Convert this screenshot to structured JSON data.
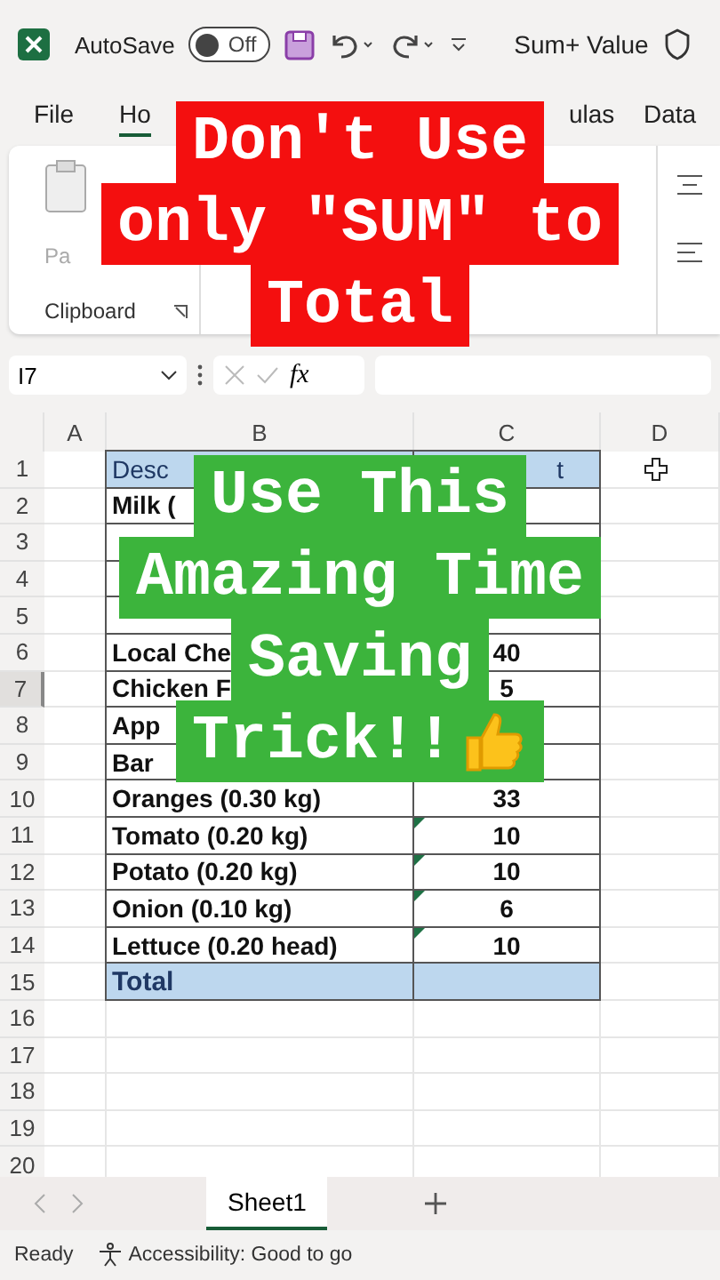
{
  "title_bar": {
    "autosave_label": "AutoSave",
    "autosave_toggle": {
      "label": "Off",
      "on": false
    },
    "document_title": "Sum+ Value"
  },
  "ribbon_tabs": [
    {
      "label": "File",
      "selected": false
    },
    {
      "label": "Ho",
      "selected": true
    },
    {
      "label": "ulas",
      "selected": false
    },
    {
      "label": "Data",
      "selected": false
    }
  ],
  "ribbon": {
    "paste_label": "Pa",
    "group_label": "Clipboard"
  },
  "formula_bar": {
    "name_box": "I7",
    "function_label": "fx"
  },
  "columns": [
    "A",
    "B",
    "C",
    "D"
  ],
  "rows": [
    {
      "number": "1",
      "kind": "header",
      "description": "Desc",
      "amount": "t",
      "selected": false
    },
    {
      "number": "2",
      "kind": "item",
      "description": "Milk (",
      "selected": false
    },
    {
      "number": "3",
      "kind": "item",
      "selected": false
    },
    {
      "number": "4",
      "kind": "item",
      "selected": false
    },
    {
      "number": "5",
      "kind": "item",
      "selected": false
    },
    {
      "number": "6",
      "kind": "item",
      "description": "Local Che",
      "amount": "40",
      "selected": false
    },
    {
      "number": "7",
      "kind": "item",
      "description": "Chicken F",
      "amount": "5",
      "selected": true
    },
    {
      "number": "8",
      "kind": "item",
      "description": "App",
      "selected": false
    },
    {
      "number": "9",
      "kind": "item",
      "description": "Bar",
      "selected": false
    },
    {
      "number": "10",
      "kind": "item",
      "description": "Oranges (0.30 kg)",
      "amount": "33",
      "selected": false,
      "flag": false
    },
    {
      "number": "11",
      "kind": "item",
      "description": "Tomato (0.20 kg)",
      "amount": "10",
      "selected": false,
      "flag": true
    },
    {
      "number": "12",
      "kind": "item",
      "description": "Potato (0.20 kg)",
      "amount": "10",
      "selected": false,
      "flag": true
    },
    {
      "number": "13",
      "kind": "item",
      "description": "Onion (0.10 kg)",
      "amount": "6",
      "selected": false,
      "flag": true
    },
    {
      "number": "14",
      "kind": "item",
      "description": "Lettuce (0.20 head)",
      "amount": "10",
      "selected": false,
      "flag": true
    },
    {
      "number": "15",
      "kind": "total",
      "description": "Total",
      "selected": false
    },
    {
      "number": "16",
      "kind": "empty",
      "selected": false
    },
    {
      "number": "17",
      "kind": "empty",
      "selected": false
    },
    {
      "number": "18",
      "kind": "empty",
      "selected": false
    },
    {
      "number": "19",
      "kind": "empty",
      "selected": false
    },
    {
      "number": "20",
      "kind": "empty",
      "selected": false
    }
  ],
  "sheet_tabs": [
    {
      "label": "Sheet1",
      "selected": true
    }
  ],
  "status_bar": {
    "mode": "Ready",
    "accessibility": "Accessibility: Good to go"
  },
  "overlays": {
    "warning": [
      "Don't Use",
      "only \"SUM\" to",
      "Total"
    ],
    "tip": [
      "Use This",
      "Amazing Time",
      "Saving",
      "Trick!!"
    ]
  }
}
